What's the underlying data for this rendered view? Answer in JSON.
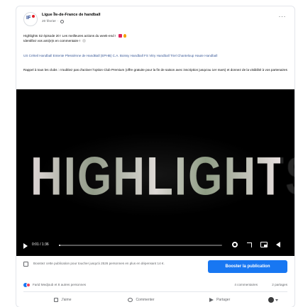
{
  "post": {
    "page_name": "Ligue Île-de-France de handball",
    "date": "20 février",
    "text_line1": "Highlights S2 épisode 20 ! Les meilleures actions du week-end !",
    "text_line2": "Identifiez vos ami(e)s en commentaire !",
    "tags": "US Créteil Handball Entente Plessiénne de HandBall (EPHB) C.A. Boissy Handball FS Vitry Handball Triel Chanteloup Haute Handball",
    "reminder": "Rappel à tous les clubs : n'oubliez pas d'activer l'option Club Premium (offre gratuite pour la fin de saison avec inscription jusqu'au 1er mars) et donnez de la visibilité à vos partenaires"
  },
  "video": {
    "overlay_title": "HIGHLIGHTS",
    "time": "0:01 / 1:36",
    "progress": 0.01
  },
  "boost": {
    "text": "Boostez cette publication pour toucher jusqu'à 2526 personnes en plus en dépensant 14 €.",
    "button_label": "Booster la publication"
  },
  "reactions": {
    "summary": "Farid Medjoub et 8 autres personnes",
    "comments": "4 commentaires",
    "shares": "2 partages"
  },
  "actions": {
    "like": "J'aime",
    "comment": "Commenter",
    "share": "Partager"
  }
}
